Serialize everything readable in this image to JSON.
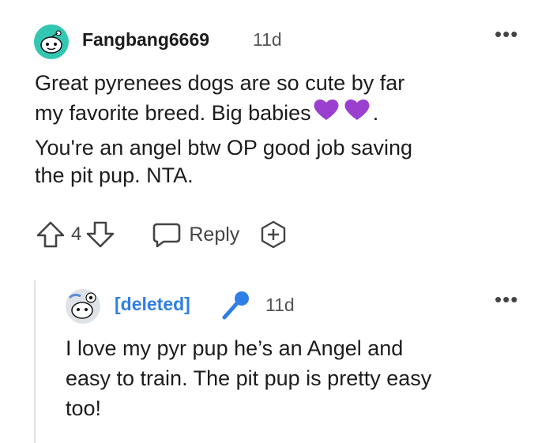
{
  "comment": {
    "username": "Fangbang6669",
    "age": "11d",
    "body": [
      "Great pyrenees dogs are so cute by far",
      "my favorite breed. Big babies",
      ".",
      "You're an angel btw OP good job saving",
      "the pit pup. NTA."
    ],
    "votes": "4",
    "reply_label": "Reply"
  },
  "reply": {
    "username": "[deleted]",
    "age": "11d",
    "body": [
      "I love my pyr pup he’s an Angel and",
      "easy to train. The pit pup is pretty easy",
      "too!"
    ]
  },
  "colors": {
    "deleted_user": "#2f7ee8",
    "heart": "#9b3fd0",
    "avatar_teal": "#33c7b3"
  }
}
